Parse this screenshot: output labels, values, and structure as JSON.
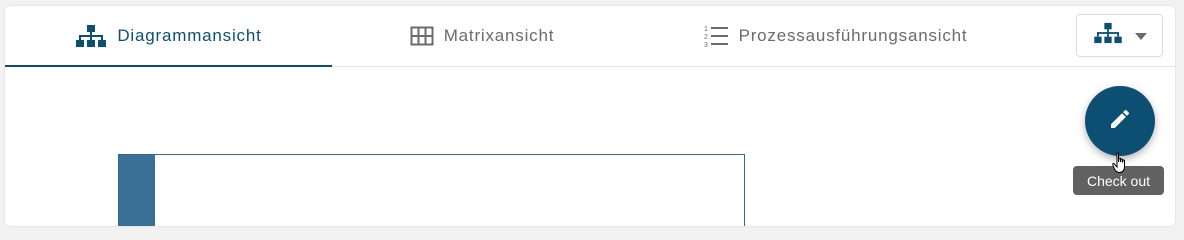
{
  "tabs": {
    "diagram": {
      "label": "Diagrammansicht",
      "icon": "hierarchy-icon",
      "active": true
    },
    "matrix": {
      "label": "Matrixansicht",
      "icon": "grid-icon",
      "active": false
    },
    "process": {
      "label": "Prozessausführungsansicht",
      "icon": "numbered-list-icon",
      "active": false
    }
  },
  "view_selector": {
    "icon": "hierarchy-icon",
    "caret": "chevron-down-icon"
  },
  "fab": {
    "icon": "pencil-icon",
    "tooltip": "Check out"
  },
  "colors": {
    "accent": "#0d4f73",
    "diagram_border": "#2f6b8e",
    "diagram_stripe": "#3a7096",
    "tooltip_bg": "#616161",
    "inactive_text": "#6b6b6b"
  }
}
